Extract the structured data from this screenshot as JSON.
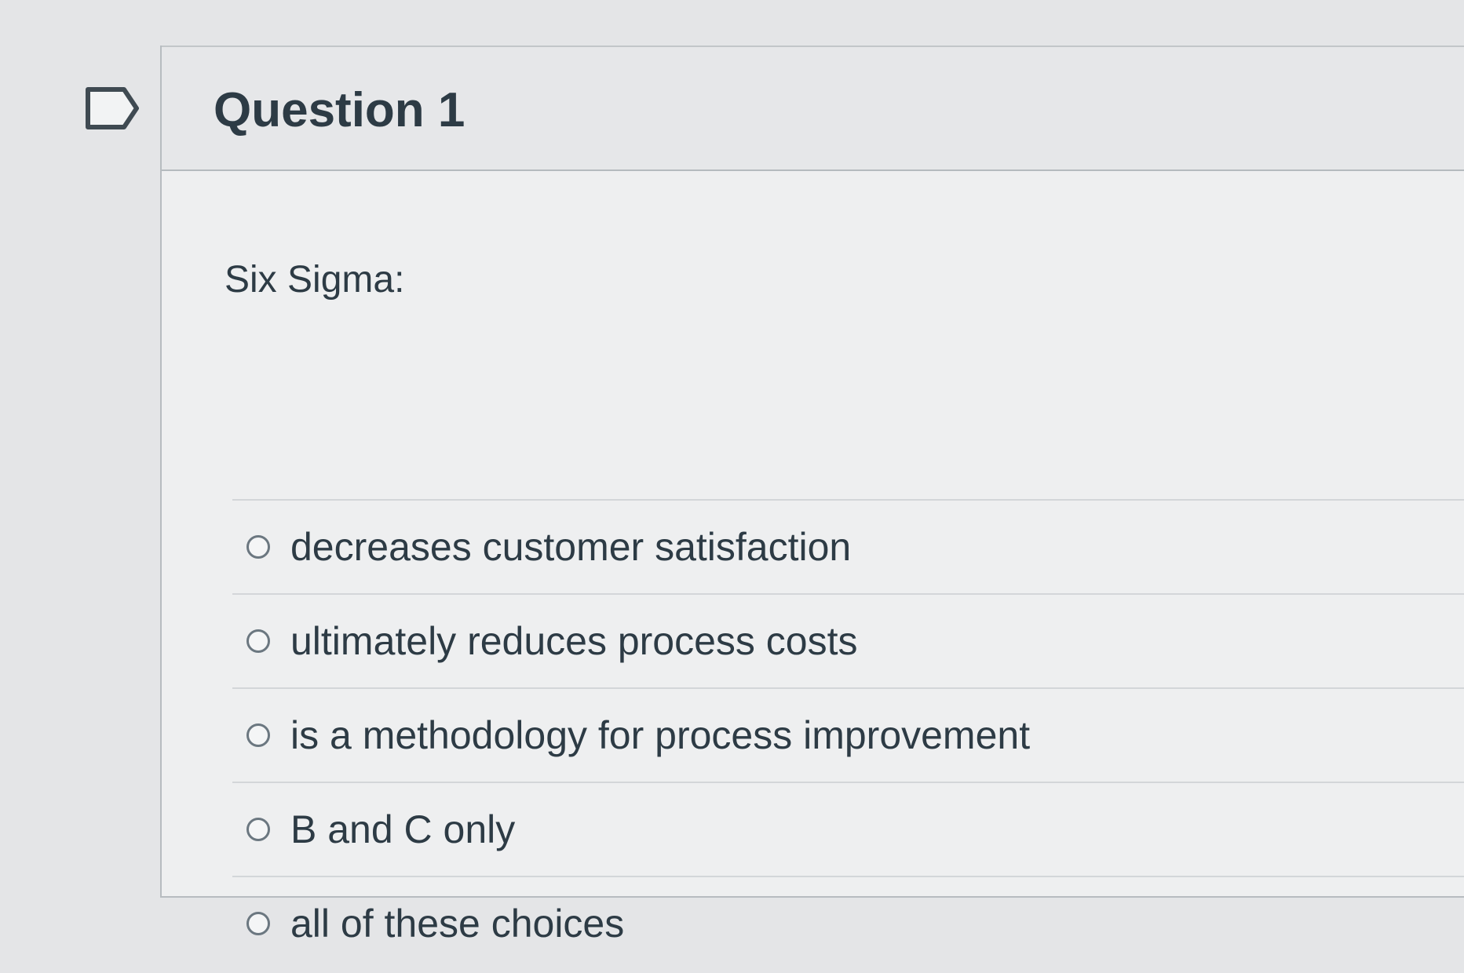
{
  "question": {
    "title": "Question 1",
    "text": "Six Sigma:",
    "flag_icon": "flag-outline-icon",
    "answers": [
      {
        "label": "decreases customer satisfaction",
        "selected": false
      },
      {
        "label": "ultimately reduces process costs",
        "selected": false
      },
      {
        "label": "is a methodology for process improvement",
        "selected": false
      },
      {
        "label": "B and C only",
        "selected": false
      },
      {
        "label": "all of these choices",
        "selected": false
      }
    ]
  }
}
